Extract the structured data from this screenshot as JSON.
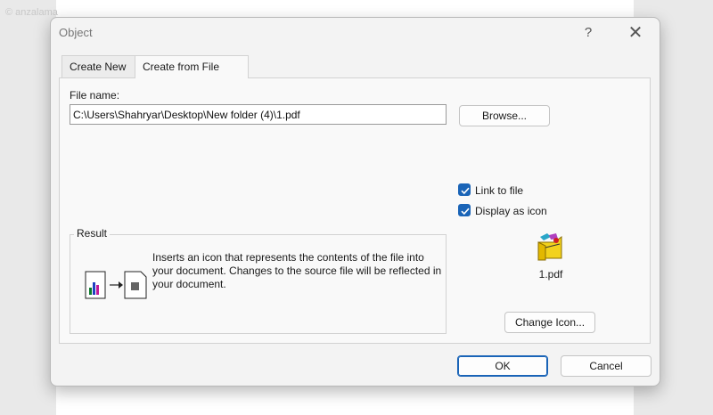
{
  "watermark": "© anzalama",
  "dialog": {
    "title": "Object",
    "help_glyph": "?",
    "close_glyph": "✕"
  },
  "tabs": [
    {
      "label": "Create New",
      "active": false
    },
    {
      "label": "Create from File",
      "active": true
    }
  ],
  "file": {
    "label": "File name:",
    "value": "C:\\Users\\Shahryar\\Desktop\\New folder (4)\\1.pdf",
    "browse_label": "Browse..."
  },
  "options": {
    "link_to_file": {
      "label": "Link to file",
      "checked": true
    },
    "display_as_icon": {
      "label": "Display as icon",
      "checked": true
    }
  },
  "result": {
    "title": "Result",
    "text": "Inserts an icon that represents the contents of the file into your document.  Changes to the source file will be reflected in your document."
  },
  "icon_preview": {
    "icon": "pdf-file-icon",
    "caption": "1.pdf",
    "change_icon_label": "Change Icon..."
  },
  "buttons": {
    "ok_label": "OK",
    "cancel_label": "Cancel"
  },
  "colors": {
    "accent": "#1a64b7"
  }
}
